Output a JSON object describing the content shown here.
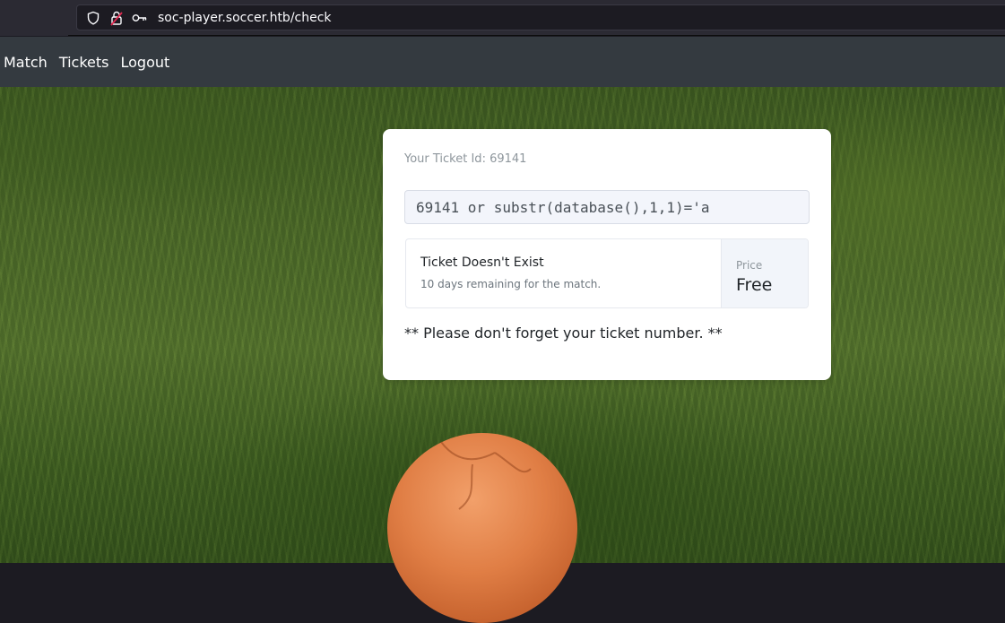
{
  "browser": {
    "url": "soc-player.soccer.htb/check",
    "icons": [
      "shield-icon",
      "lock-icon",
      "key-icon"
    ]
  },
  "navbar": {
    "links": [
      {
        "label": "Match"
      },
      {
        "label": "Tickets"
      },
      {
        "label": "Logout"
      }
    ]
  },
  "ticket_card": {
    "ticket_id_text": "Your Ticket Id: 69141",
    "input_value": "69141 or substr(database(),1,1)='a",
    "result": {
      "title": "Ticket Doesn't Exist",
      "subtitle": "10 days remaining for the match.",
      "price_label": "Price",
      "price_value": "Free"
    },
    "reminder": "** Please don't forget your ticket number. **"
  },
  "colors": {
    "navbar_bg": "#343a40",
    "card_bg": "#ffffff",
    "ball": "#e07e45"
  }
}
